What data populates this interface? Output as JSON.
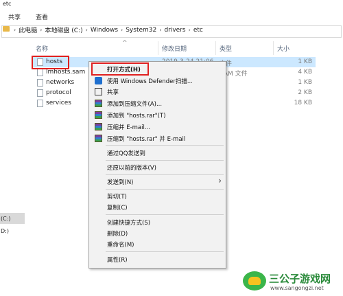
{
  "window": {
    "title": "etc"
  },
  "ribbon": {
    "tabs": [
      "共享",
      "查看"
    ]
  },
  "address": {
    "crumbs": [
      "此电脑",
      "本地磁盘 (C:)",
      "Windows",
      "System32",
      "drivers",
      "etc"
    ]
  },
  "nav": {
    "items": [
      "(C:)",
      "D:)"
    ]
  },
  "columns": {
    "name": "名称",
    "date": "修改日期",
    "type": "类型",
    "size": "大小"
  },
  "files": [
    {
      "name": "hosts",
      "date": "2019-3-24 21:06",
      "type": "文件",
      "size": "1 KB"
    },
    {
      "name": "lmhosts.sam",
      "date": "",
      "type": "SAM 文件",
      "size": "4 KB"
    },
    {
      "name": "networks",
      "date": "",
      "type": "件",
      "size": "1 KB"
    },
    {
      "name": "protocol",
      "date": "",
      "type": "件",
      "size": "2 KB"
    },
    {
      "name": "services",
      "date": "",
      "type": "件",
      "size": "18 KB"
    }
  ],
  "context_menu": {
    "items": [
      {
        "label": "打开方式(H)",
        "icon": "none"
      },
      {
        "label": "使用 Windows Defender扫描...",
        "icon": "defender-shield-icon"
      },
      {
        "label": "共享",
        "icon": "share-icon"
      },
      {
        "label": "添加到压缩文件(A)...",
        "icon": "winrar-icon"
      },
      {
        "label": "添加到 \"hosts.rar\"(T)",
        "icon": "winrar-icon"
      },
      {
        "label": "压缩并 E-mail...",
        "icon": "winrar-icon"
      },
      {
        "label": "压缩到 \"hosts.rar\" 并 E-mail",
        "icon": "winrar-icon"
      },
      {
        "label": "通过QQ发送到",
        "icon": "none"
      },
      {
        "label": "还原以前的版本(V)",
        "icon": "none"
      },
      {
        "label": "发送到(N)",
        "icon": "none"
      },
      {
        "label": "剪切(T)",
        "icon": "none"
      },
      {
        "label": "复制(C)",
        "icon": "none"
      },
      {
        "label": "创建快捷方式(S)",
        "icon": "none"
      },
      {
        "label": "删除(D)",
        "icon": "none"
      },
      {
        "label": "重命名(M)",
        "icon": "none"
      },
      {
        "label": "属性(R)",
        "icon": "none"
      }
    ],
    "submenu_arrow": "›"
  },
  "annotation": {
    "color": "#e02020"
  },
  "watermark": {
    "text": "三公子游戏网",
    "url": "www.sangongzi.net"
  }
}
